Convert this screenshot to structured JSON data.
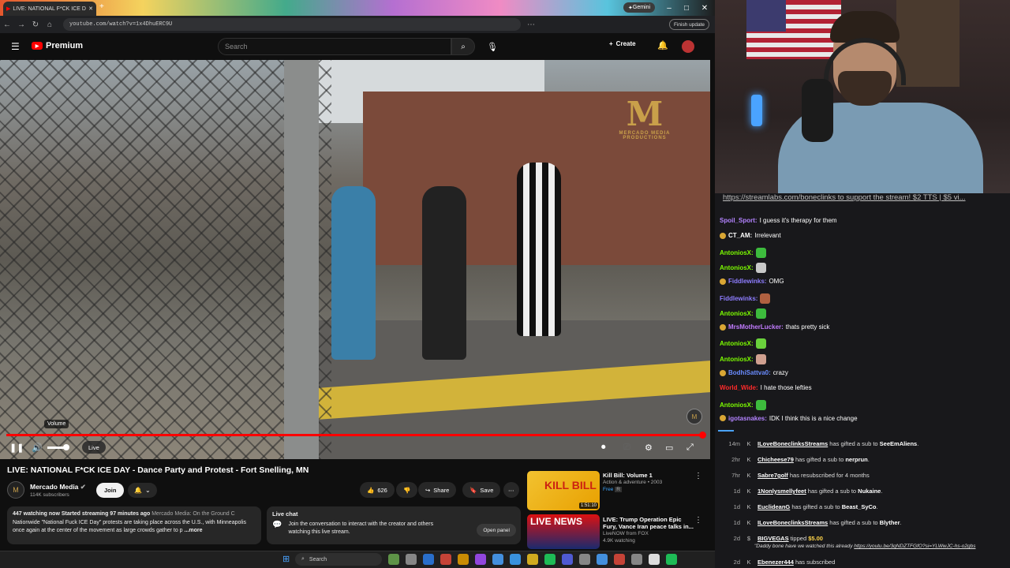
{
  "browser": {
    "tab_title": "LIVE: NATIONAL F*CK ICE D",
    "url": "youtube.com/watch?v=1x4DhuERC9U",
    "gemini_label": "Gemini",
    "finish_update_label": "Finish update"
  },
  "youtube": {
    "logo_text": "Premium",
    "search_placeholder": "Search",
    "create_label": "Create"
  },
  "player": {
    "volume_tooltip": "Volume",
    "live_label": "Live",
    "watermark_letter": "M",
    "watermark_text": "MERCADO MEDIA PRODUCTIONS",
    "channel_watermark": "M",
    "progress_fraction": 1.0
  },
  "video_info": {
    "title": "LIVE: NATIONAL F*CK ICE DAY - Dance Party and Protest - Fort Snelling, MN",
    "channel_name": "Mercado Media",
    "channel_avatar": "M",
    "subscribers": "114K subscribers",
    "join_label": "Join",
    "likes": "626",
    "share_label": "Share",
    "save_label": "Save",
    "description_stats": "447 watching now  Started streaming 97 minutes ago",
    "description_channel": "Mercado Media: On the Ground C",
    "description_text": "Nationwide \"National Fuck ICE Day\" protests are taking place across the U.S., with Minneapolis once again at the center of the movement as large crowds gather to p",
    "more_label": "...more",
    "live_chat_title": "Live chat",
    "live_chat_text": "Join the conversation to interact with the creator and others watching this live stream.",
    "open_panel_label": "Open panel"
  },
  "recommendations": [
    {
      "title": "Kill Bill: Volume 1",
      "meta": "Action & adventure • 2003",
      "badge": "Free",
      "rating": "R",
      "duration": "1:51:10",
      "thumb_text": "KILL BILL"
    },
    {
      "title": "LIVE: Trump Operation Epic Fury, Vance Iran peace talks in...",
      "meta": "LiveNOW from FOX",
      "watching": "4.9K watching",
      "thumb_text": "LIVE NEWS"
    }
  ],
  "stream": {
    "top_line_link": "https://streamlabs.com/boneclinks",
    "top_line_rest": " to support the stream! $2 TTS | $5 vi..."
  },
  "chat_messages": [
    {
      "user": "Spoil_Sport",
      "color": "#b383ff",
      "text": "I guess it's therapy for them",
      "badge": false,
      "emote": ""
    },
    {
      "user": "CT_AM",
      "color": "#ffffff",
      "text": "Irrelevant",
      "badge": true,
      "emote": ""
    },
    {
      "user": "AntoniosX",
      "color": "#7cfc00",
      "text": "",
      "badge": false,
      "emote": "#3dbb3d"
    },
    {
      "user": "AntoniosX",
      "color": "#7cfc00",
      "text": "",
      "badge": false,
      "emote": "#c8c8c8"
    },
    {
      "user": "Fiddlewinks",
      "color": "#8e7dff",
      "text": "OMG",
      "badge": true,
      "emote": ""
    },
    {
      "user": "Fiddlewinks",
      "color": "#8e7dff",
      "text": "",
      "badge": false,
      "emote": "#b06040"
    },
    {
      "user": "AntoniosX",
      "color": "#7cfc00",
      "text": "",
      "badge": false,
      "emote": "#3dbb3d"
    },
    {
      "user": "MrsMotherLucker",
      "color": "#c27cff",
      "text": "thats pretty sick",
      "badge": true,
      "emote": ""
    },
    {
      "user": "AntoniosX",
      "color": "#7cfc00",
      "text": "",
      "badge": false,
      "emote": "#6ad13c"
    },
    {
      "user": "AntoniosX",
      "color": "#7cfc00",
      "text": "",
      "badge": false,
      "emote": "#d0a090"
    },
    {
      "user": "BodhiSattva0",
      "color": "#6a8cff",
      "text": "crazy",
      "badge": true,
      "emote": ""
    },
    {
      "user": "World_Wide",
      "color": "#ff2a2a",
      "text": "I hate those lefties",
      "badge": false,
      "emote": ""
    },
    {
      "user": "AntoniosX",
      "color": "#7cfc00",
      "text": "",
      "badge": false,
      "emote": "#3dbb3d"
    },
    {
      "user": "igotasnakes",
      "color": "#b383ff",
      "text": "IDK I think this is a nice change",
      "badge": true,
      "emote": ""
    }
  ],
  "events": [
    {
      "time": "14m",
      "user": "ILoveBoneclinksStreams",
      "text": " has gifted a sub to ",
      "target": "SeeEmAliens",
      "tail": "."
    },
    {
      "time": "2hr",
      "user": "Chicheese79",
      "text": " has gifted a sub to ",
      "target": "nerprun",
      "tail": "."
    },
    {
      "time": "7hr",
      "user": "Sabre7golf",
      "text": " has resubscribed for 4 months",
      "target": "",
      "tail": ""
    },
    {
      "time": "1d",
      "user": "1Nonlysmellyfeet",
      "text": " has gifted a sub to ",
      "target": "Nukaine",
      "tail": "."
    },
    {
      "time": "1d",
      "user": "EuclideanG",
      "text": " has gifted a sub to ",
      "target": "Beast_SyCo",
      "tail": "."
    },
    {
      "time": "1d",
      "user": "ILoveBoneclinksStreams",
      "text": " has gifted a sub to ",
      "target": "Blyther",
      "tail": "."
    },
    {
      "time": "2d",
      "user": "BIGVEGAS",
      "text": " tipped ",
      "target": "$5.00",
      "tail": "",
      "quote": "\"Daddy bone have we watched this already ",
      "link": "https://youtu.be/3qNDZTFGfO?si=YLWwJC-hs-o2gbs"
    },
    {
      "time": "2d",
      "user": "Ebenezer444",
      "text": " has subscribed",
      "target": "",
      "tail": ""
    }
  ],
  "taskbar": {
    "search_label": "Search"
  }
}
